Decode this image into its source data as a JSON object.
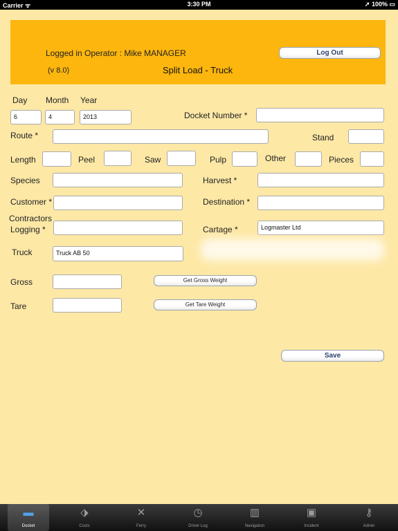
{
  "status": {
    "carrier": "Carrier ᯤ",
    "time": "3:30 PM",
    "battery": "➚ 100% ▭"
  },
  "banner": {
    "operator": "Logged in Operator : Mike MANAGER",
    "version": "(v 8.0)",
    "mode": "Split Load - Truck",
    "logout": "Log Out"
  },
  "labels": {
    "day": "Day",
    "month": "Month",
    "year": "Year",
    "docket": "Docket Number *",
    "route": "Route *",
    "stand": "Stand",
    "length": "Length",
    "peel": "Peel",
    "saw": "Saw",
    "pulp": "Pulp",
    "other": "Other",
    "pieces": "Pieces",
    "species": "Species",
    "harvest": "Harvest *",
    "customer": "Customer *",
    "destination": "Destination *",
    "contractors": "Contractors",
    "logging": "Logging *",
    "cartage": "Cartage *",
    "truck": "Truck",
    "gross": "Gross",
    "tare": "Tare"
  },
  "values": {
    "day": "6",
    "month": "4",
    "year": "2013",
    "docket": "",
    "route": "",
    "stand": "",
    "length": "",
    "peel": "",
    "saw": "",
    "pulp": "",
    "other": "",
    "pieces": "",
    "species": "",
    "harvest": "",
    "customer": "",
    "destination": "",
    "logging": "",
    "cartage": "Logmaster Ltd",
    "truck": "Truck AB 50",
    "gross": "",
    "tare": ""
  },
  "buttons": {
    "gross": "Get Gross Weight",
    "tare": "Get Tare Weight",
    "save": "Save"
  },
  "tabs": [
    {
      "label": "Docket",
      "icon": "▬"
    },
    {
      "label": "Costs",
      "icon": "⬗"
    },
    {
      "label": "Ferry",
      "icon": "✕"
    },
    {
      "label": "Driver Log",
      "icon": "◷"
    },
    {
      "label": "Navigation",
      "icon": "▥"
    },
    {
      "label": "Incident",
      "icon": "▣"
    },
    {
      "label": "Admin",
      "icon": "⚷"
    }
  ],
  "colors": {
    "background": "#fde8a6",
    "banner": "#fdb60d",
    "tab_active": "#4fa3ea"
  }
}
